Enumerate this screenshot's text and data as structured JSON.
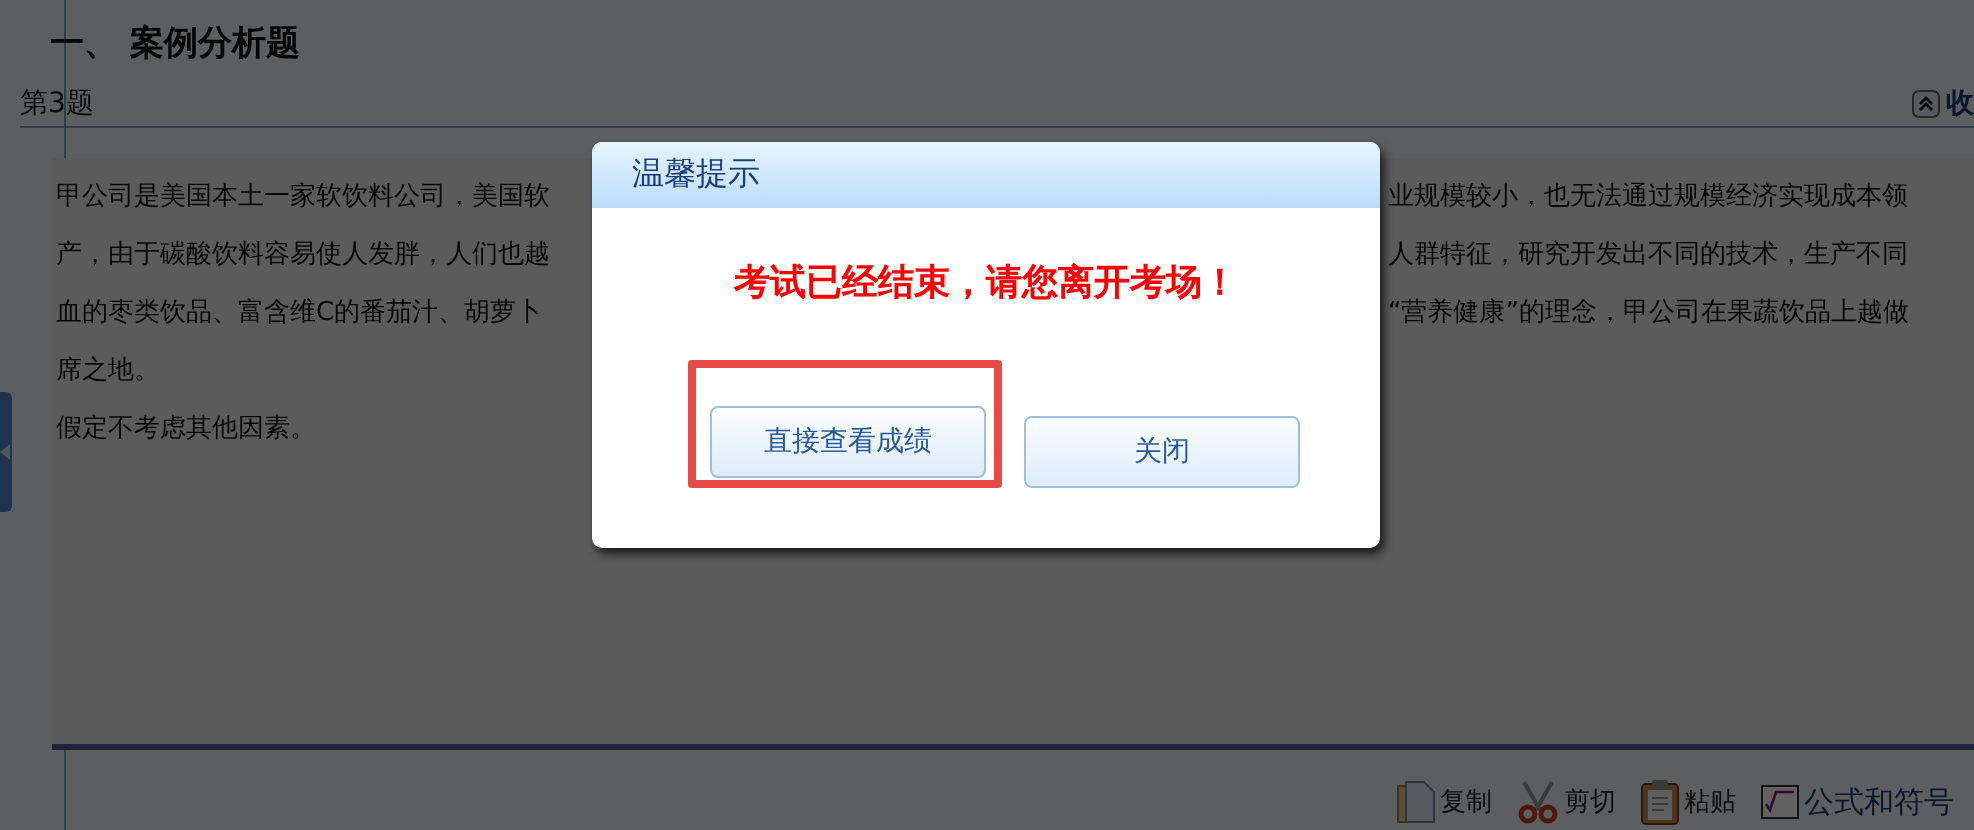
{
  "section_title": "一、 案例分析题",
  "question": {
    "label": "第3题",
    "collapse_label": "收"
  },
  "passage": {
    "lines": [
      {
        "left": "甲公司是美国本土一家软饮料公司，美国软",
        "right": "业规模较小，也无法通过规模经济实现成本领"
      },
      {
        "left": "产，由于碳酸饮料容易使人发胖，人们也越",
        "right": "人群特征，研究开发出不同的技术，生产不同"
      },
      {
        "left": "血的枣类饮品、富含维C的番茄汁、胡萝卜",
        "right": "“营养健康”的理念，甲公司在果蔬饮品上越做"
      },
      {
        "left": "席之地。"
      },
      {
        "left": "假定不考虑其他因素。"
      }
    ]
  },
  "toolbar": [
    {
      "kind": "copy",
      "label": "复制"
    },
    {
      "kind": "cut",
      "label": "剪切"
    },
    {
      "kind": "paste",
      "label": "粘贴"
    },
    {
      "kind": "formula",
      "label": "公式和符号"
    }
  ],
  "dialog": {
    "title": "温馨提示",
    "message": "考试已经结束，请您离开考场！",
    "buttons": [
      {
        "label": "直接查看成绩",
        "highlighted": true
      },
      {
        "label": "关闭",
        "highlighted": false
      }
    ]
  }
}
